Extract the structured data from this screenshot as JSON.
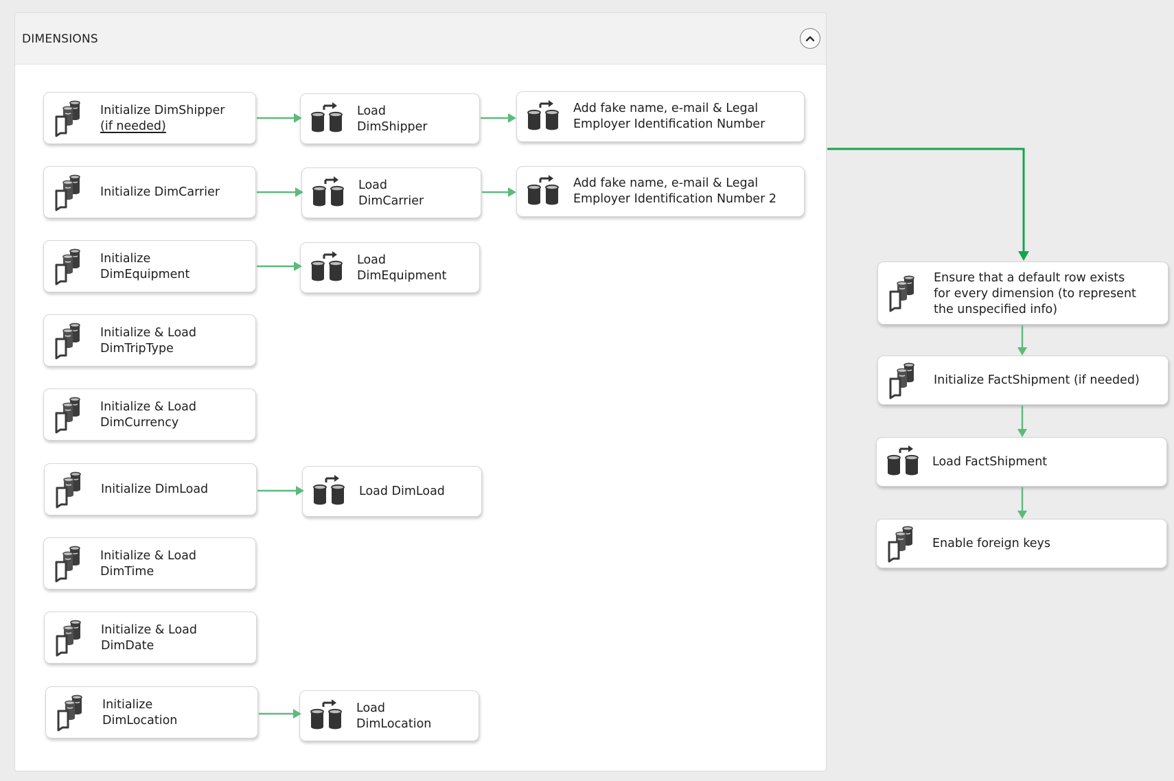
{
  "container": {
    "title": "DIMENSIONS",
    "collapse_icon": "chevron-up-icon"
  },
  "tasks": {
    "init_dimshipper": {
      "line1": "Initialize DimShipper",
      "line2": "(if needed)",
      "icon": "execute-sql-icon"
    },
    "load_dimshipper": {
      "line1": "Load",
      "line2": "DimShipper",
      "icon": "data-flow-icon"
    },
    "fake_1": {
      "line1": "Add fake name, e-mail & Legal",
      "line2": "Employer Identification Number",
      "icon": "data-flow-icon"
    },
    "init_dimcarrier": {
      "line1": "Initialize DimCarrier",
      "icon": "execute-sql-icon"
    },
    "load_dimcarrier": {
      "line1": "Load",
      "line2": "DimCarrier",
      "icon": "data-flow-icon"
    },
    "fake_2": {
      "line1": "Add fake name, e-mail & Legal",
      "line2": "Employer Identification Number 2",
      "icon": "data-flow-icon"
    },
    "init_dimequipment": {
      "line1": "Initialize",
      "line2": "DimEquipment",
      "icon": "execute-sql-icon"
    },
    "load_dimequipment": {
      "line1": "Load",
      "line2": "DimEquipment",
      "icon": "data-flow-icon"
    },
    "init_load_dimtriptype": {
      "line1": "Initialize & Load",
      "line2": "DimTripType",
      "icon": "execute-sql-icon"
    },
    "init_load_dimcurrency": {
      "line1": "Initialize & Load",
      "line2": "DimCurrency",
      "icon": "execute-sql-icon"
    },
    "init_dimload": {
      "line1": "Initialize DimLoad",
      "icon": "execute-sql-icon"
    },
    "load_dimload": {
      "line1": "Load DimLoad",
      "icon": "data-flow-icon"
    },
    "init_load_dimtime": {
      "line1": "Initialize & Load",
      "line2": "DimTime",
      "icon": "execute-sql-icon"
    },
    "init_load_dimdate": {
      "line1": "Initialize & Load",
      "line2": "DimDate",
      "icon": "execute-sql-icon"
    },
    "init_dimlocation": {
      "line1": "Initialize",
      "line2": "DimLocation",
      "icon": "execute-sql-icon"
    },
    "load_dimlocation": {
      "line1": "Load",
      "line2": "DimLocation",
      "icon": "data-flow-icon"
    },
    "ensure_default_row": {
      "line1": "Ensure that a default row exists",
      "line2": "for every dimension (to represent",
      "line3": "the unspecified info)",
      "icon": "execute-sql-icon"
    },
    "init_factshipment": {
      "line1": "Initialize FactShipment (if needed)",
      "icon": "execute-sql-icon"
    },
    "load_factshipment": {
      "line1": "Load FactShipment",
      "icon": "data-flow-icon"
    },
    "enable_fk": {
      "line1": "Enable foreign keys",
      "icon": "execute-sql-icon"
    }
  },
  "colors": {
    "dimension_edge": "#5cba7d",
    "main_edge": "#14a44d",
    "canvas": "#ececec",
    "container_header": "#f2f2f2"
  }
}
